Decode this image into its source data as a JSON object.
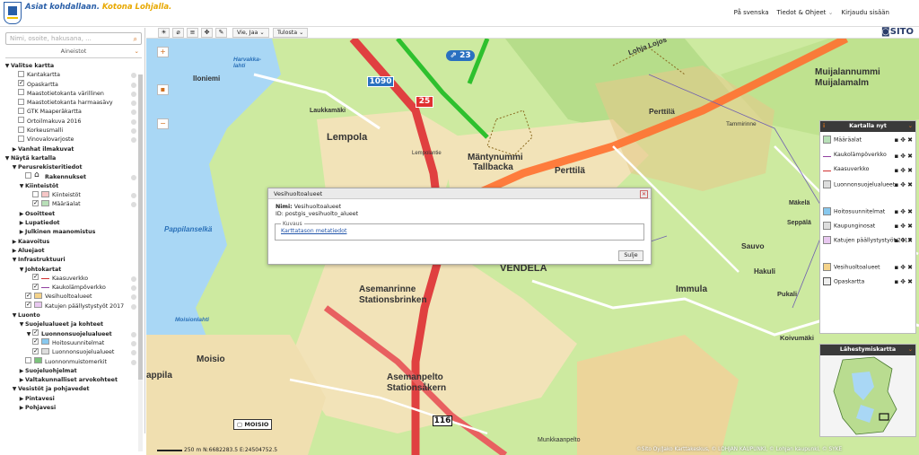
{
  "header": {
    "slogan_main": "Asiat kohdallaan.",
    "slogan_accent": "Kotona Lohjalla.",
    "links": [
      "På svenska",
      "Tiedot & Ohjeet",
      "Kirjaudu sisään"
    ],
    "brand": "SITO"
  },
  "search": {
    "placeholder": "Nimi, osoite, hakusana, ..."
  },
  "panel": {
    "title": "Aineistot"
  },
  "tree": [
    {
      "t": "Valitse kartta",
      "lvl": 0,
      "exp": "▼",
      "bold": true
    },
    {
      "t": "Kantakartta",
      "lvl": 2,
      "cb": false
    },
    {
      "t": "Opaskartta",
      "lvl": 2,
      "cb": true
    },
    {
      "t": "Maastotietokanta värillinen",
      "lvl": 2,
      "cb": false
    },
    {
      "t": "Maastotietokanta harmaasävy",
      "lvl": 2,
      "cb": false
    },
    {
      "t": "GTK Maaperäkartta",
      "lvl": 2,
      "cb": false
    },
    {
      "t": "Ortoilmakuva 2016",
      "lvl": 2,
      "cb": false
    },
    {
      "t": "Korkeusmalli",
      "lvl": 2,
      "cb": false
    },
    {
      "t": "Vinovalovarjoste",
      "lvl": 2,
      "cb": false
    },
    {
      "t": "Vanhat ilmakuvat",
      "lvl": 1,
      "exp": "▶",
      "bold": true
    },
    {
      "t": "Näytä kartalla",
      "lvl": 0,
      "exp": "▼",
      "bold": true
    },
    {
      "t": "Perusrekisteritiedot",
      "lvl": 1,
      "exp": "▼",
      "bold": true
    },
    {
      "t": "Rakennukset",
      "lvl": 3,
      "cb": false,
      "bold": true,
      "sw": "house"
    },
    {
      "t": "Kiinteistöt",
      "lvl": 2,
      "exp": "▼",
      "bold": true
    },
    {
      "t": "Kiinteistöt",
      "lvl": 4,
      "cb": false,
      "sw": "#f6c6c6"
    },
    {
      "t": "Määräalat",
      "lvl": 4,
      "cb": true,
      "sw": "#b8e0b8"
    },
    {
      "t": "Osoitteet",
      "lvl": 2,
      "exp": "▶",
      "bold": true
    },
    {
      "t": "Lupatiedot",
      "lvl": 2,
      "exp": "▶",
      "bold": true
    },
    {
      "t": "Julkinen maanomistus",
      "lvl": 2,
      "exp": "▶",
      "bold": true
    },
    {
      "t": "Kaavoitus",
      "lvl": 1,
      "exp": "▶",
      "bold": true
    },
    {
      "t": "Aluejaot",
      "lvl": 1,
      "exp": "▶",
      "bold": true
    },
    {
      "t": "Infrastruktuuri",
      "lvl": 1,
      "exp": "▼",
      "bold": true
    },
    {
      "t": "Johtokartat",
      "lvl": 2,
      "exp": "▼",
      "bold": true
    },
    {
      "t": "Kaasuverkko",
      "lvl": 4,
      "cb": true,
      "sw": "line-red"
    },
    {
      "t": "Kaukolämpöverkko",
      "lvl": 4,
      "cb": true,
      "sw": "line-purple"
    },
    {
      "t": "Vesihuoltoalueet",
      "lvl": 3,
      "cb": true,
      "sw": "#f5d38a"
    },
    {
      "t": "Katujen päällystystyöt 2017",
      "lvl": 3,
      "cb": true,
      "sw": "#e8c8f0"
    },
    {
      "t": "Luonto",
      "lvl": 1,
      "exp": "▼",
      "bold": true
    },
    {
      "t": "Suojelualueet ja kohteet",
      "lvl": 2,
      "exp": "▼",
      "bold": true
    },
    {
      "t": "Luonnonsuojelualueet",
      "lvl": 3,
      "cb": true,
      "exp": "▼",
      "bold": true
    },
    {
      "t": "Hoitosuunnitelmat",
      "lvl": 4,
      "cb": true,
      "sw": "#88c8ee"
    },
    {
      "t": "Luonnonsuojelualueet",
      "lvl": 4,
      "cb": true,
      "sw": "#dddddd"
    },
    {
      "t": "Luonnonmuistomerkit",
      "lvl": 3,
      "cb": false,
      "sw": "#7cc47c"
    },
    {
      "t": "Suojeluohjelmat",
      "lvl": 2,
      "exp": "▶",
      "bold": true
    },
    {
      "t": "Valtakunnalliset arvokohteet",
      "lvl": 2,
      "exp": "▶",
      "bold": true
    },
    {
      "t": "Vesistöt ja pohjavedet",
      "lvl": 1,
      "exp": "▼",
      "bold": true
    },
    {
      "t": "Pintavesi",
      "lvl": 2,
      "exp": "▶",
      "bold": true
    },
    {
      "t": "Pohjavesi",
      "lvl": 2,
      "exp": "▶",
      "bold": true
    }
  ],
  "toolbar": {
    "vie": "Vie, Jaa",
    "tulosta": "Tulosta"
  },
  "map_labels": {
    "harvakkalahti": "Harvakka- lahti",
    "iloniemi": "Iloniemi",
    "laukkamaki": "Laukkamäki",
    "lempola": "Lempola",
    "lempolantie": "Lempolantie",
    "manty1": "Mäntynummi",
    "manty2": "Tallbacka",
    "perttila": "Perttilä",
    "perttila2": "Perttilä",
    "muija1": "Muijalannummi",
    "muija2": "Muijalamalm",
    "tammirinne": "Tammirinne",
    "pappilanselka": "Pappilanselkä",
    "vendela": "VENDELA",
    "asemanrinne1": "Asemanrinne",
    "asemanrinne2": "Stationsbrinken",
    "immula": "Immula",
    "sauvo": "Sauvo",
    "hakuli": "Hakuli",
    "pukali": "Pukali",
    "koivumaki": "Koivumäki",
    "moisio": "Moisio",
    "moisionlahti": "Moisionlahti",
    "asemanpelto1": "Asemanpelto",
    "asemanpelto2": "Stationsåkern",
    "pappila": "appila",
    "munkkaanpelto": "Munkkaanpelto",
    "lohja_lojo": "Lohja Lojos",
    "makela": "Mäkelä",
    "seppala": "Seppälä",
    "road1090": "1090",
    "road25": "25",
    "road23": "23",
    "road116": "116",
    "moisio_marker": "MOISIO"
  },
  "popup": {
    "title": "Vesihuoltoalueet",
    "name_label": "Nimi:",
    "name_value": "Vesihuoltoalueet",
    "id_label": "ID:",
    "id_value": "postgis_vesihuolto_alueet",
    "legend": "Kuvaus",
    "link": "Karttatason metatiedot",
    "close": "Sulje"
  },
  "on_map": {
    "title": "Kartalla nyt",
    "items": [
      {
        "name": "Määräalat",
        "color": "#b8e0b8"
      },
      {
        "name": "Kaukolämpöverkko",
        "color": "line-purple"
      },
      {
        "name": "Kaasuverkko",
        "color": "line-red"
      },
      {
        "name": "Luonnonsuojelualueet",
        "color": "#dddddd"
      },
      {
        "name": "Hoitosuunnitelmat",
        "color": "#88c8ee"
      },
      {
        "name": "Kaupunginosat",
        "color": "#dddddd"
      },
      {
        "name": "Katujen päällystystyöt 2017",
        "color": "#e8c8f0"
      },
      {
        "name": "Vesihuoltoalueet",
        "color": "#f5d38a"
      },
      {
        "name": "Opaskartta",
        "color": "grid"
      }
    ]
  },
  "overview": {
    "title": "Lähestymiskartta"
  },
  "footer": {
    "scale": "250 m",
    "coords": "N:6682283.5 E:24504752.5",
    "attribution": "©Sito Oy/Jako Karttakeskus, © LOHJAN KAUPUNKI, © Lohjan kaupunki, © SYKE"
  }
}
